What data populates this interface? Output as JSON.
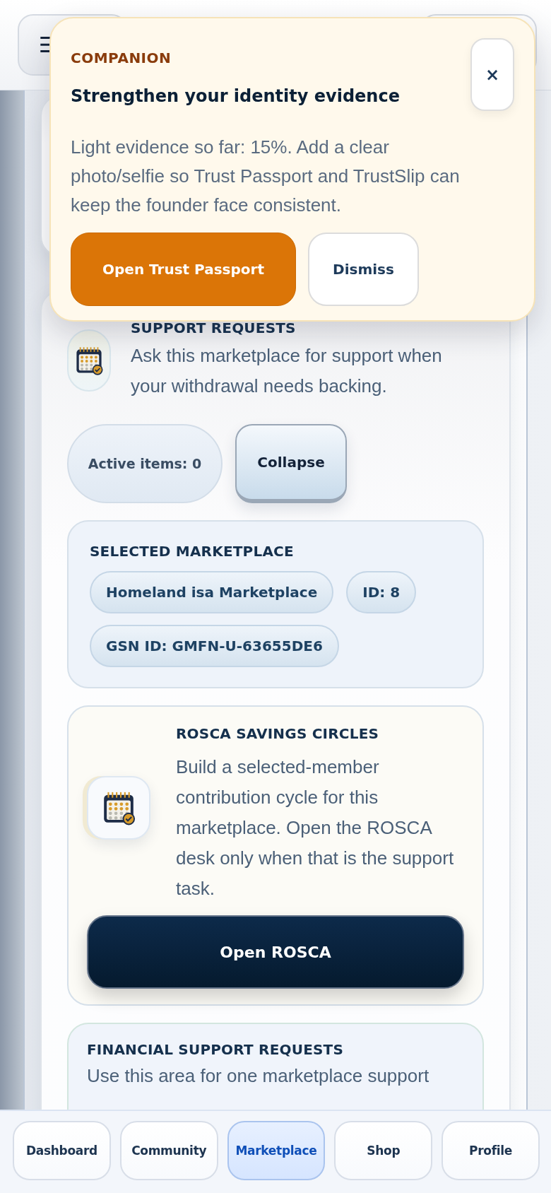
{
  "header": {
    "menu_icon": "☰"
  },
  "companion": {
    "eyebrow": "COMPANION",
    "title": "Strengthen your identity evidence",
    "body": "Light evidence so far: 15%. Add a clear photo/selfie so Trust Passport and TrustSlip can keep the founder face consistent.",
    "close": "×",
    "actions": [
      {
        "label": "Open Trust Passport",
        "kind": "primary"
      },
      {
        "label": "Dismiss",
        "kind": "secondary"
      }
    ]
  },
  "support": {
    "title": "SUPPORT REQUESTS",
    "description": "Ask this marketplace for support when your withdrawal needs backing.",
    "active_items": "Active items: 0",
    "toggle": "Collapse"
  },
  "selected_marketplace": {
    "title": "SELECTED MARKETPLACE",
    "chips": [
      "Homeland isa Marketplace",
      "ID: 8",
      "GSN ID: GMFN-U-63655DE6"
    ]
  },
  "rosca": {
    "title": "ROSCA SAVINGS CIRCLES",
    "description": "Build a selected-member contribution cycle for this marketplace. Open the ROSCA desk only when that is the support task.",
    "button": "Open ROSCA"
  },
  "financial": {
    "title": "FINANCIAL SUPPORT REQUESTS",
    "description": "Use this area for one marketplace support"
  },
  "nav": [
    {
      "label": "Dashboard",
      "selected": false
    },
    {
      "label": "Community",
      "selected": false
    },
    {
      "label": "Marketplace",
      "selected": true
    },
    {
      "label": "Shop",
      "selected": false
    },
    {
      "label": "Profile",
      "selected": false
    }
  ]
}
